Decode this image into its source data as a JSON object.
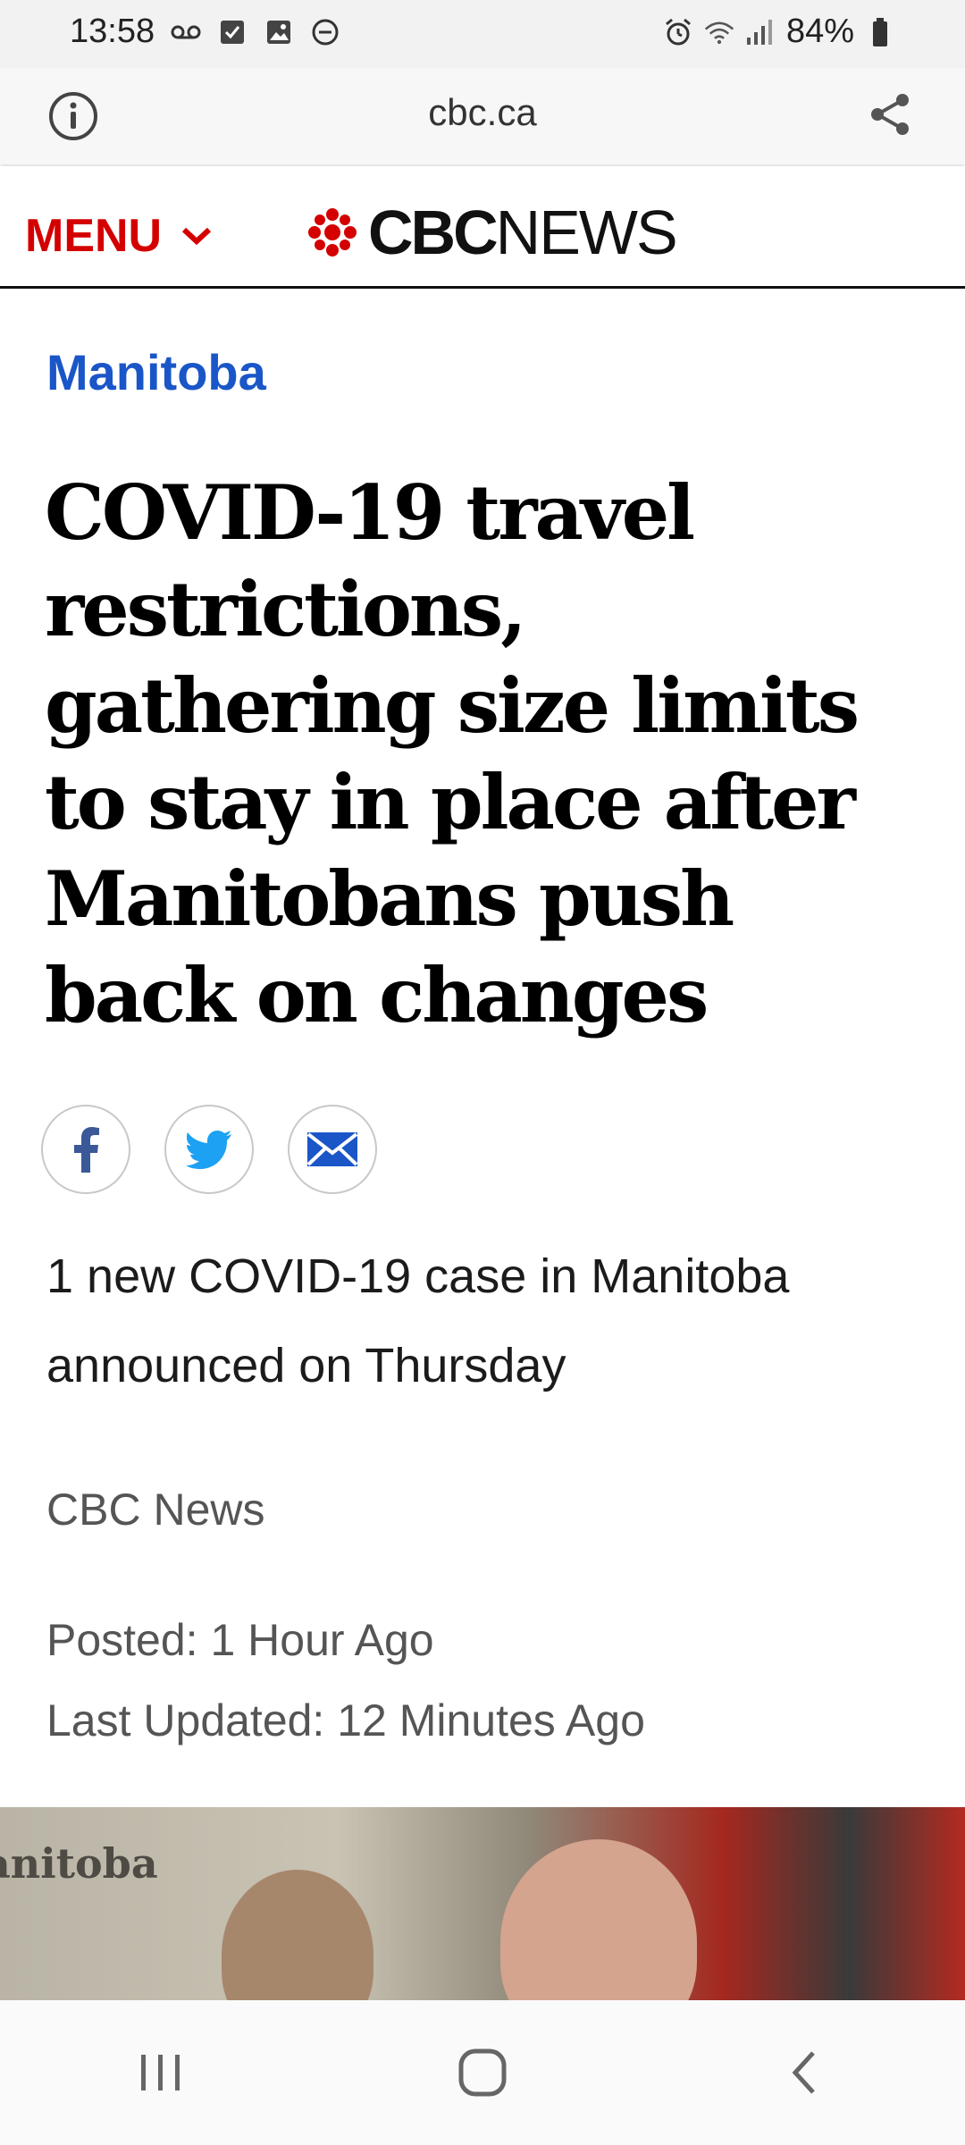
{
  "status_bar": {
    "time": "13:58",
    "battery": "84%",
    "left_icons": [
      "voicemail-icon",
      "checkbox-icon",
      "image-icon",
      "do-not-disturb-icon"
    ],
    "right_icons": [
      "alarm-icon",
      "wifi-icon",
      "signal-icon",
      "battery-icon"
    ]
  },
  "browser": {
    "url": "cbc.ca",
    "icons": [
      "info-icon",
      "share-icon"
    ]
  },
  "site_header": {
    "menu_label": "MENU",
    "logo_cbc": "CBC",
    "logo_news": "NEWS",
    "brand_color": "#d40000"
  },
  "article": {
    "section": "Manitoba",
    "section_color": "#1a56c8",
    "headline": "COVID-19 travel restrictions, gathering size limits to stay in place after Manitobans push back on changes",
    "share_icons": [
      "facebook-icon",
      "twitter-icon",
      "email-icon"
    ],
    "deck": "1 new COVID-19 case in Manitoba announced on Thursday",
    "byline": "CBC News",
    "posted": "Posted: 1 Hour Ago",
    "updated": "Last Updated: 12 Minutes Ago",
    "hero_text": "anitoba"
  },
  "nav_bar": {
    "buttons": [
      "recents-icon",
      "home-icon",
      "back-icon"
    ]
  }
}
